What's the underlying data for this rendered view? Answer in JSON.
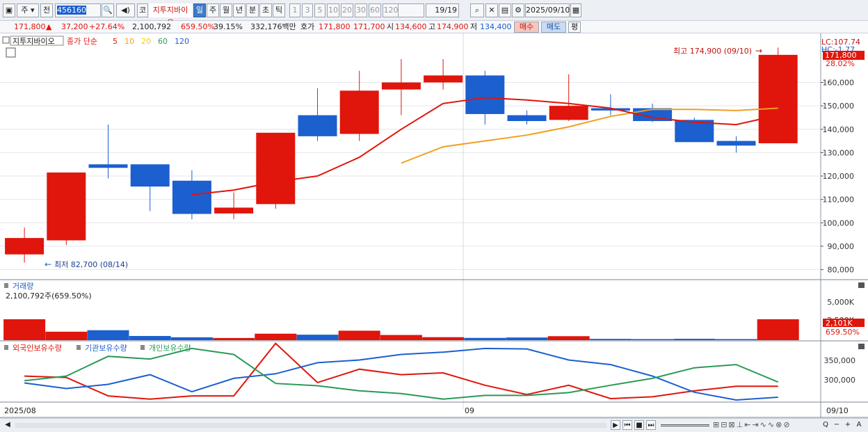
{
  "toolbar": {
    "menu_icon": "▣",
    "period": "주",
    "scope": "전",
    "code": "456160",
    "search_icon": "🔍",
    "speaker_icon": "◀)",
    "market_tag": "코",
    "stock_name": "지투지바이오",
    "intervals": [
      "일",
      "주",
      "월",
      "년",
      "분",
      "초",
      "틱"
    ],
    "minutes": [
      "1",
      "3",
      "5",
      "10",
      "20",
      "30",
      "60",
      "120"
    ],
    "page": "19/19",
    "date": "2025/09/10"
  },
  "info": {
    "price": "171,800",
    "direction": "▲",
    "change": "37,200",
    "change_pct": "+27.64%",
    "volume": "2,100,792",
    "volume_pct": "659.50%",
    "turnover": "39.15%",
    "amount": "332,176백만",
    "quote_label": "호가",
    "ask": "171,800",
    "bid": "171,700",
    "open_label": "시",
    "open": "134,600",
    "high_label": "고",
    "high": "174,900",
    "low_label": "저",
    "low": "134,400",
    "buy": "매수",
    "sell": "매도",
    "avg": "평"
  },
  "legend": {
    "name": "지투지바이오",
    "ma_label": "종가 단순",
    "ma": [
      {
        "period": "5",
        "color": "#e0150b"
      },
      {
        "period": "10",
        "color": "#f0a020"
      },
      {
        "period": "20",
        "color": "#f0d000"
      },
      {
        "period": "60",
        "color": "#2a9a55"
      },
      {
        "period": "120",
        "color": "#1c5fcf"
      }
    ]
  },
  "annotations": {
    "max": "최고 174,900 (09/10)",
    "min": "최저 82,700 (08/14)",
    "lc": "LC:107.74",
    "hc": "HC:-1.77",
    "last_price": "171,800",
    "last_pct": "28.02%"
  },
  "volume_panel": {
    "title": "거래량",
    "value": "2,100,792주(659.50%)",
    "axis": [
      "5,000K",
      "2,500K"
    ],
    "last": "2,101K",
    "last_pct": "659.50%"
  },
  "holdings": {
    "labels": [
      {
        "text": "외국인보유수량",
        "color": "#e0150b"
      },
      {
        "text": "기관보유수량",
        "color": "#1c5fcf"
      },
      {
        "text": "개인보유수량",
        "color": "#2a9a55"
      }
    ],
    "axis": [
      "350,000",
      "300,000"
    ]
  },
  "xaxis": {
    "start": "2025/08",
    "mid": "09",
    "end": "09/10"
  },
  "bottom": {
    "nav": [
      "▶",
      "⏮",
      "■",
      "⏭"
    ],
    "tools": [
      "Q",
      "−",
      "+",
      "A"
    ]
  },
  "colors": {
    "up": "#e0150b",
    "down": "#1c5fcf",
    "ma5": "#e0150b",
    "ma10": "#f0a020",
    "foreign": "#e0150b",
    "inst": "#1c5fcf",
    "indiv": "#2a9a55"
  },
  "chart_data": [
    {
      "type": "candlestick",
      "y_ticks": [
        80000,
        90000,
        100000,
        110000,
        120000,
        130000,
        140000,
        150000,
        160000
      ],
      "ylim": [
        76000,
        178000
      ],
      "candles": [
        {
          "o": 86500,
          "h": 98000,
          "l": 83000,
          "c": 93500
        },
        {
          "o": 92500,
          "h": 121500,
          "l": 90500,
          "c": 121500
        },
        {
          "o": 125000,
          "h": 142000,
          "l": 119000,
          "c": 123500
        },
        {
          "o": 125000,
          "h": 125000,
          "l": 105000,
          "c": 115500
        },
        {
          "o": 118000,
          "h": 122500,
          "l": 101500,
          "c": 103800
        },
        {
          "o": 104000,
          "h": 113000,
          "l": 101500,
          "c": 106500
        },
        {
          "o": 108000,
          "h": 138500,
          "l": 106000,
          "c": 138500
        },
        {
          "o": 146000,
          "h": 157500,
          "l": 135000,
          "c": 137000
        },
        {
          "o": 138000,
          "h": 165000,
          "l": 135000,
          "c": 156500
        },
        {
          "o": 157000,
          "h": 170000,
          "l": 146000,
          "c": 160000
        },
        {
          "o": 160000,
          "h": 170000,
          "l": 157000,
          "c": 163000
        },
        {
          "o": 163000,
          "h": 165000,
          "l": 142000,
          "c": 146500
        },
        {
          "o": 146000,
          "h": 148000,
          "l": 142000,
          "c": 143500
        },
        {
          "o": 144000,
          "h": 163500,
          "l": 143500,
          "c": 150000
        },
        {
          "o": 149000,
          "h": 155000,
          "l": 146000,
          "c": 148000
        },
        {
          "o": 149000,
          "h": 151000,
          "l": 143000,
          "c": 143500
        },
        {
          "o": 144000,
          "h": 145000,
          "l": 135000,
          "c": 134500
        },
        {
          "o": 135000,
          "h": 137000,
          "l": 130000,
          "c": 133000
        },
        {
          "o": 134000,
          "h": 174900,
          "l": 134000,
          "c": 171800
        }
      ],
      "ma5": [
        null,
        null,
        null,
        null,
        112000,
        114000,
        117500,
        120000,
        128000,
        140000,
        151000,
        153500,
        152500,
        151000,
        149000,
        145000,
        143000,
        142000,
        146000
      ],
      "ma10": [
        null,
        null,
        null,
        null,
        null,
        null,
        null,
        null,
        null,
        125500,
        132500,
        135000,
        137500,
        141000,
        145500,
        148500,
        148500,
        148000,
        149000
      ]
    },
    {
      "type": "bar",
      "values": [
        2100,
        850,
        1000,
        420,
        290,
        220,
        650,
        550,
        950,
        520,
        300,
        230,
        270,
        400,
        130,
        110,
        140,
        110,
        2100
      ],
      "ylim": [
        0,
        6000
      ]
    },
    {
      "type": "line",
      "ylim": [
        250000,
        380000
      ],
      "series": [
        {
          "name": "외국인보유수량",
          "values": [
            305000,
            302000,
            262000,
            255000,
            262000,
            262000,
            376000,
            291000,
            320000,
            308000,
            312000,
            285000,
            265000,
            285000,
            256000,
            260000,
            273000,
            283000,
            283000
          ]
        },
        {
          "name": "기관보유수량",
          "values": [
            290000,
            278000,
            287000,
            308000,
            271000,
            300000,
            310000,
            334000,
            340000,
            352000,
            357000,
            365000,
            364000,
            340000,
            330000,
            305000,
            270000,
            253000,
            259000
          ]
        },
        {
          "name": "개인보유수량",
          "values": [
            295000,
            305000,
            348000,
            342000,
            365000,
            352000,
            289000,
            284000,
            273000,
            267000,
            255000,
            263000,
            263000,
            269000,
            285000,
            300000,
            323000,
            330000,
            292000
          ]
        }
      ]
    }
  ]
}
